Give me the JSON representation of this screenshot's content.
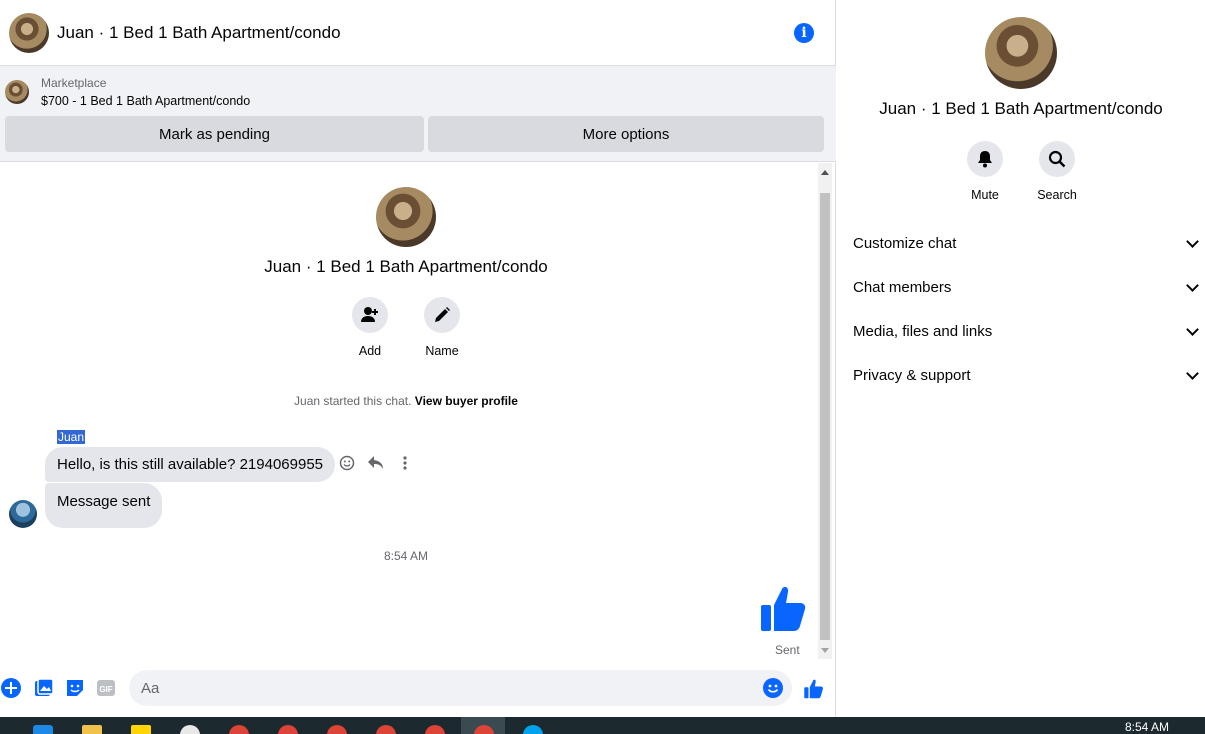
{
  "chat": {
    "title": "Juan · 1 Bed 1 Bath Apartment/condo",
    "info_icon": "info-icon"
  },
  "marketplace": {
    "label": "Marketplace",
    "item": "$700 - 1 Bed 1 Bath Apartment/condo",
    "pending_button": "Mark as pending",
    "more_button": "More options"
  },
  "profile": {
    "name": "Juan · 1 Bed 1 Bath Apartment/condo",
    "add_label": "Add",
    "name_label": "Name"
  },
  "started": {
    "text": "Juan started this chat.",
    "link": "View buyer profile"
  },
  "messages": {
    "sender": "Juan",
    "first": "Hello, is this still available? 2194069955",
    "second": "Message sent",
    "timestamp": "8:54 AM",
    "sent_label": "Sent"
  },
  "composer": {
    "placeholder": "Aa"
  },
  "info": {
    "name": "Juan · 1 Bed 1 Bath Apartment/condo",
    "mute_label": "Mute",
    "search_label": "Search",
    "sections": [
      "Customize chat",
      "Chat members",
      "Media, files and links",
      "Privacy & support"
    ]
  },
  "taskbar": {
    "time": "8:54 AM"
  },
  "colors": {
    "accent": "#0866ff",
    "bubble": "#e4e6eb",
    "panel": "#f0f2f5"
  }
}
